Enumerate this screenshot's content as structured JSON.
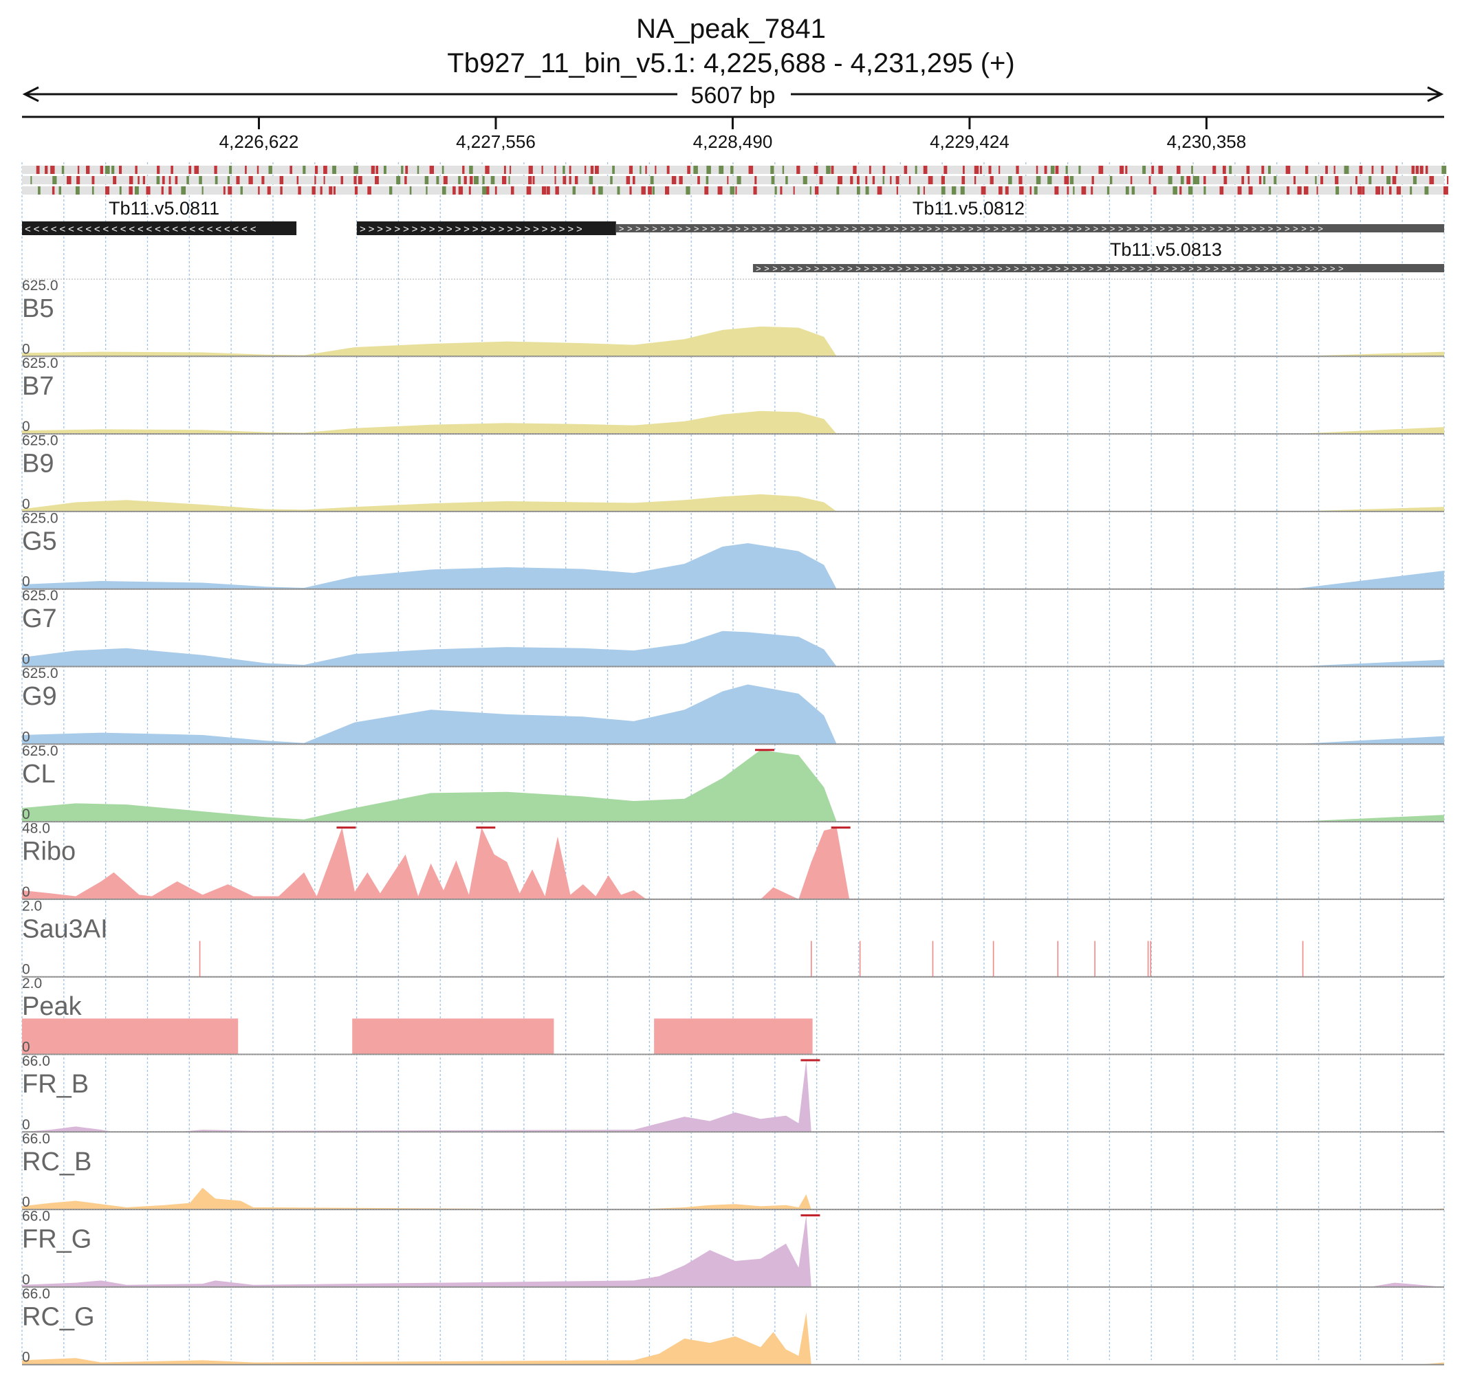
{
  "header": {
    "title": "NA_peak_7841",
    "subtitle": "Tb927_11_bin_v5.1: 4,225,688 - 4,231,295 (+)",
    "span_label": "5607 bp"
  },
  "chart_data": {
    "type": "area",
    "region": {
      "chrom": "Tb927_11_bin_v5.1",
      "start": 4225688,
      "end": 4231295,
      "strand": "+"
    },
    "ruler": {
      "ticks": [
        4226622,
        4227556,
        4228490,
        4229424,
        4230358
      ],
      "tick_labels": [
        "4,226,622",
        "4,227,556",
        "4,228,490",
        "4,229,424",
        "4,230,358"
      ]
    },
    "grid": true,
    "genes": [
      {
        "name": "Tb11.v5.0811",
        "start": 4225688,
        "end": 4226770,
        "strand": "-",
        "cds": true,
        "row": 0
      },
      {
        "name": "Tb11.v5.0812",
        "start": 4227008,
        "end": 4228030,
        "strand": "+",
        "cds": true,
        "row": 0
      },
      {
        "name": "Tb11.v5.0812",
        "start": 4228030,
        "end": 4231295,
        "strand": "+",
        "cds": false,
        "row": 0
      },
      {
        "name": "Tb11.v5.0813",
        "start": 4228570,
        "end": 4231295,
        "strand": "+",
        "cds": false,
        "row": 1
      }
    ],
    "gene_labels": [
      {
        "text": "Tb11.v5.0811",
        "pos": 4226248
      },
      {
        "text": "Tb11.v5.0812",
        "pos": 4229420
      },
      {
        "text": "Tb11.v5.0813",
        "pos": 4230198
      }
    ],
    "tracks": [
      {
        "name": "B5",
        "max": "625.0",
        "min": "0",
        "color": "#e8e09a",
        "kind": "area",
        "x": [
          4225688,
          4226000,
          4226400,
          4226650,
          4226800,
          4227000,
          4227300,
          4227600,
          4227900,
          4228100,
          4228300,
          4228450,
          4228600,
          4228750,
          4228850,
          4228900,
          4230700,
          4231295
        ],
        "y": [
          30,
          40,
          35,
          15,
          10,
          80,
          110,
          130,
          115,
          100,
          150,
          230,
          260,
          250,
          170,
          0,
          0,
          40
        ]
      },
      {
        "name": "B7",
        "max": "625.0",
        "min": "0",
        "color": "#e8e09a",
        "kind": "area",
        "x": [
          4225688,
          4226000,
          4226400,
          4226650,
          4226800,
          4227000,
          4227300,
          4227600,
          4227900,
          4228100,
          4228300,
          4228450,
          4228600,
          4228750,
          4228850,
          4228900,
          4230700,
          4231295
        ],
        "y": [
          30,
          40,
          35,
          15,
          10,
          50,
          80,
          95,
          85,
          75,
          110,
          170,
          200,
          190,
          130,
          0,
          0,
          60
        ]
      },
      {
        "name": "B9",
        "max": "625.0",
        "min": "0",
        "color": "#e8e09a",
        "kind": "area",
        "x": [
          4225688,
          4225900,
          4226100,
          4226400,
          4226650,
          4226800,
          4227000,
          4227300,
          4227600,
          4227900,
          4228100,
          4228300,
          4228450,
          4228600,
          4228750,
          4228850,
          4228900,
          4230700,
          4231295
        ],
        "y": [
          20,
          80,
          100,
          60,
          20,
          15,
          40,
          70,
          90,
          80,
          75,
          100,
          130,
          150,
          130,
          80,
          0,
          0,
          40
        ]
      },
      {
        "name": "G5",
        "max": "625.0",
        "min": "0",
        "color": "#a8cbea",
        "kind": "area",
        "x": [
          4225688,
          4226000,
          4226400,
          4226650,
          4226800,
          4227000,
          4227300,
          4227600,
          4227900,
          4228100,
          4228300,
          4228450,
          4228550,
          4228750,
          4228850,
          4228900,
          4230700,
          4231295
        ],
        "y": [
          40,
          70,
          55,
          20,
          10,
          110,
          170,
          190,
          175,
          140,
          220,
          370,
          400,
          330,
          210,
          0,
          0,
          160
        ]
      },
      {
        "name": "G7",
        "max": "625.0",
        "min": "0",
        "color": "#a8cbea",
        "kind": "area",
        "x": [
          4225688,
          4225900,
          4226100,
          4226400,
          4226650,
          4226800,
          4227000,
          4227300,
          4227600,
          4227900,
          4228100,
          4228300,
          4228450,
          4228550,
          4228750,
          4228850,
          4228900,
          4230700,
          4231295
        ],
        "y": [
          80,
          140,
          160,
          100,
          30,
          15,
          110,
          150,
          170,
          160,
          140,
          200,
          310,
          300,
          260,
          150,
          0,
          0,
          60
        ]
      },
      {
        "name": "G9",
        "max": "625.0",
        "min": "0",
        "color": "#a8cbea",
        "kind": "area",
        "x": [
          4225688,
          4226000,
          4226400,
          4226650,
          4226800,
          4227000,
          4227300,
          4227600,
          4227900,
          4228100,
          4228300,
          4228450,
          4228550,
          4228750,
          4228850,
          4228900,
          4230700,
          4231295
        ],
        "y": [
          80,
          100,
          80,
          30,
          10,
          190,
          300,
          260,
          240,
          200,
          300,
          460,
          520,
          440,
          250,
          0,
          0,
          70
        ]
      },
      {
        "name": "CL",
        "max": "625.0",
        "min": "0",
        "color": "#a6d9a1",
        "kind": "area",
        "x": [
          4225688,
          4225900,
          4226100,
          4226400,
          4226650,
          4226800,
          4227000,
          4227300,
          4227600,
          4227900,
          4228100,
          4228300,
          4228450,
          4228600,
          4228750,
          4228850,
          4228900,
          4230700,
          4231295
        ],
        "y": [
          120,
          160,
          150,
          90,
          40,
          20,
          120,
          250,
          260,
          220,
          180,
          200,
          380,
          625,
          580,
          300,
          0,
          0,
          60
        ]
      },
      {
        "name": "Ribo",
        "max": "48.0",
        "min": "0",
        "color": "#f4a3a3",
        "kind": "area",
        "x": [
          4225688,
          4225800,
          4225900,
          4226000,
          4226050,
          4226150,
          4226200,
          4226300,
          4226400,
          4226500,
          4226600,
          4226700,
          4226800,
          4226850,
          4226900,
          4226950,
          4227000,
          4227050,
          4227100,
          4227200,
          4227250,
          4227300,
          4227350,
          4227400,
          4227450,
          4227500,
          4227550,
          4227600,
          4227650,
          4227700,
          4227750,
          4227800,
          4227850,
          4227900,
          4227950,
          4228000,
          4228050,
          4228100,
          4228150,
          4228600,
          4228650,
          4228750,
          4228800,
          4228850,
          4228900,
          4228950,
          4231295
        ],
        "y": [
          6,
          4,
          2,
          12,
          18,
          3,
          2,
          12,
          3,
          10,
          2,
          2,
          18,
          2,
          25,
          48,
          5,
          18,
          4,
          30,
          2,
          24,
          6,
          26,
          3,
          48,
          30,
          25,
          4,
          20,
          2,
          42,
          3,
          10,
          2,
          16,
          3,
          6,
          0,
          0,
          8,
          0,
          25,
          46,
          48,
          0,
          0
        ]
      },
      {
        "name": "Sau3AI",
        "max": "2.0",
        "min": "0",
        "color": "#f08888",
        "kind": "sticks",
        "x": [
          4226389,
          4228800,
          4228992,
          4229279,
          4229518,
          4229772,
          4229918,
          4230128,
          4230138,
          4230738
        ],
        "y": [
          1,
          1,
          1,
          1,
          1,
          1,
          1,
          1,
          1,
          1
        ]
      },
      {
        "name": "Peak",
        "max": "2.0",
        "min": "0",
        "color": "#f4a3a3",
        "kind": "blocks",
        "blocks": [
          [
            4225688,
            4226540
          ],
          [
            4226990,
            4227785
          ],
          [
            4228180,
            4228805
          ]
        ],
        "y": 1
      },
      {
        "name": "FR_B",
        "max": "66.0",
        "min": "0",
        "color": "#d8b7d8",
        "kind": "area",
        "x": [
          4225688,
          4225800,
          4225900,
          4226000,
          4226050,
          4226300,
          4226400,
          4226600,
          4228100,
          4228200,
          4228300,
          4228400,
          4228500,
          4228600,
          4228700,
          4228750,
          4228780,
          4228800,
          4231200,
          4231295
        ],
        "y": [
          0,
          2,
          5,
          2,
          0,
          0,
          2,
          1,
          2,
          8,
          14,
          10,
          18,
          12,
          15,
          8,
          66,
          0,
          0,
          1
        ]
      },
      {
        "name": "RC_B",
        "max": "66.0",
        "min": "0",
        "color": "#fbcc8c",
        "kind": "area",
        "x": [
          4225688,
          4225800,
          4225900,
          4226000,
          4226100,
          4226250,
          4226350,
          4226400,
          4226450,
          4226550,
          4226600,
          4228100,
          4228300,
          4228400,
          4228500,
          4228600,
          4228700,
          4228750,
          4228780,
          4228800,
          4231200,
          4231295
        ],
        "y": [
          3,
          6,
          8,
          5,
          2,
          4,
          6,
          20,
          10,
          8,
          2,
          0,
          2,
          4,
          5,
          3,
          4,
          2,
          14,
          0,
          0,
          1
        ]
      },
      {
        "name": "FR_G",
        "max": "66.0",
        "min": "0",
        "color": "#d8b7d8",
        "kind": "area",
        "x": [
          4225688,
          4225900,
          4226000,
          4226100,
          4226400,
          4226450,
          4226600,
          4228100,
          4228200,
          4228300,
          4228400,
          4228500,
          4228600,
          4228700,
          4228750,
          4228780,
          4228800,
          4231000,
          4231100,
          4231295
        ],
        "y": [
          2,
          4,
          6,
          2,
          3,
          6,
          2,
          6,
          10,
          20,
          34,
          24,
          26,
          40,
          18,
          66,
          0,
          0,
          4,
          0
        ]
      },
      {
        "name": "RC_G",
        "max": "66.0",
        "min": "0",
        "color": "#fbcc8c",
        "kind": "area",
        "x": [
          4225688,
          4225900,
          4226000,
          4226200,
          4226400,
          4226600,
          4228100,
          4228200,
          4228300,
          4228400,
          4228500,
          4228600,
          4228650,
          4228700,
          4228750,
          4228780,
          4228800,
          4231200,
          4231295
        ],
        "y": [
          4,
          6,
          2,
          3,
          4,
          2,
          4,
          10,
          24,
          20,
          26,
          16,
          30,
          14,
          8,
          48,
          0,
          0,
          2
        ]
      }
    ]
  }
}
